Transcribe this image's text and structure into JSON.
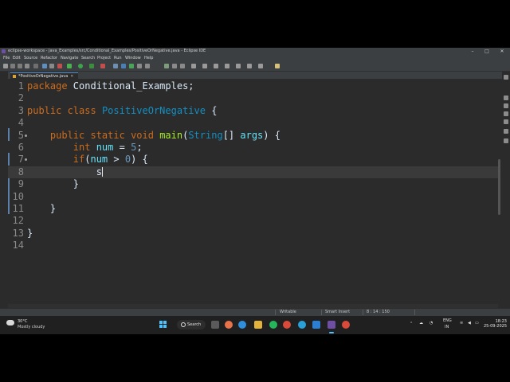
{
  "window": {
    "title": "eclipse-workspace - Java_Examples/src/Conditional_Examples/PositiveOrNegative.java - Eclipse IDE",
    "minimize": "–",
    "maximize": "□",
    "close": "✕"
  },
  "menu": [
    "File",
    "Edit",
    "Source",
    "Refactor",
    "Navigate",
    "Search",
    "Project",
    "Run",
    "Window",
    "Help"
  ],
  "editor_tab": {
    "label": "*PositiveOrNegative.java",
    "close": "✕"
  },
  "code_lines": [
    {
      "n": "1",
      "tokens": [
        {
          "t": "package ",
          "c": "kw"
        },
        {
          "t": "Conditional_Examples;",
          "c": "pl"
        }
      ]
    },
    {
      "n": "2",
      "tokens": []
    },
    {
      "n": "3",
      "tokens": [
        {
          "t": "public ",
          "c": "kw"
        },
        {
          "t": "class ",
          "c": "kw"
        },
        {
          "t": "PositiveOrNegative",
          "c": "cls"
        },
        {
          "t": " {",
          "c": "pl"
        }
      ]
    },
    {
      "n": "4",
      "tokens": []
    },
    {
      "n": "5",
      "fold": true,
      "tokens": [
        {
          "t": "    public ",
          "c": "kw"
        },
        {
          "t": "static ",
          "c": "kw"
        },
        {
          "t": "void ",
          "c": "kw"
        },
        {
          "t": "main",
          "c": "mt"
        },
        {
          "t": "(",
          "c": "pl"
        },
        {
          "t": "String",
          "c": "cls"
        },
        {
          "t": "[] ",
          "c": "pl"
        },
        {
          "t": "args",
          "c": "vr"
        },
        {
          "t": ") {",
          "c": "pl"
        }
      ]
    },
    {
      "n": "6",
      "tokens": [
        {
          "t": "        int ",
          "c": "kw"
        },
        {
          "t": "num",
          "c": "vr"
        },
        {
          "t": " = ",
          "c": "pl"
        },
        {
          "t": "5",
          "c": "num"
        },
        {
          "t": ";",
          "c": "pl"
        }
      ]
    },
    {
      "n": "7",
      "fold": true,
      "tokens": [
        {
          "t": "        if",
          "c": "kw"
        },
        {
          "t": "(",
          "c": "pl"
        },
        {
          "t": "num",
          "c": "vr"
        },
        {
          "t": " > ",
          "c": "pl"
        },
        {
          "t": "0",
          "c": "num"
        },
        {
          "t": ") {",
          "c": "pl"
        }
      ]
    },
    {
      "n": "8",
      "current": true,
      "tokens": [
        {
          "t": "            s",
          "c": "pl"
        }
      ]
    },
    {
      "n": "9",
      "tokens": [
        {
          "t": "        }",
          "c": "pl"
        }
      ]
    },
    {
      "n": "10",
      "tokens": []
    },
    {
      "n": "11",
      "tokens": [
        {
          "t": "    }",
          "c": "pl"
        }
      ]
    },
    {
      "n": "12",
      "tokens": []
    },
    {
      "n": "13",
      "tokens": [
        {
          "t": "}",
          "c": "pl"
        }
      ]
    },
    {
      "n": "14",
      "tokens": []
    }
  ],
  "status": {
    "mode": "Writable",
    "insert": "Smart Insert",
    "position": "8 : 14 : 150"
  },
  "taskbar": {
    "weather_temp": "30°C",
    "weather_cond": "Mostly cloudy",
    "search_label": "Search",
    "lang": "ENG",
    "region": "IN",
    "time": "18:23",
    "date": "25-09-2025"
  },
  "colors": {
    "editor_bg": "#2b2b2b",
    "keyword": "#cc6c1d",
    "class": "#1290c3",
    "variable": "#66e1f8",
    "method": "#a7ec21",
    "number": "#6897bb"
  }
}
